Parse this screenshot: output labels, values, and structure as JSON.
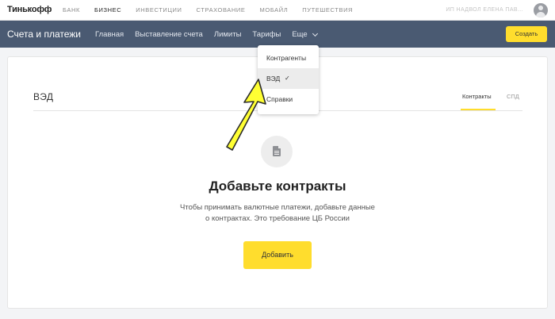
{
  "topbar": {
    "logo": "Тинькофф",
    "nav": [
      "БАНК",
      "БИЗНЕС",
      "ИНВЕСТИЦИИ",
      "СТРАХОВАНИЕ",
      "МОБАЙЛ",
      "ПУТЕШЕСТВИЯ"
    ],
    "active": "БИЗНЕС",
    "username": "ИП НАДВОЛ ЕЛЕНА ПАВ..."
  },
  "navbar": {
    "title": "Счета и платежи",
    "items": [
      "Главная",
      "Выставление счета",
      "Лимиты",
      "Тарифы",
      "Еще"
    ],
    "create_label": "Создать"
  },
  "dropdown": {
    "items": [
      {
        "label": "Контрагенты"
      },
      {
        "label": "ВЭД",
        "check": "✓"
      },
      {
        "label": "Справки"
      }
    ]
  },
  "card": {
    "title": "ВЭД",
    "tabs": [
      {
        "label": "Контракты"
      },
      {
        "label": "СПД"
      }
    ],
    "empty_title": "Добавьте контракты",
    "empty_desc_line1": "Чтобы принимать валютные платежи, добавьте данные",
    "empty_desc_line2": "о контрактах. Это требование ЦБ России",
    "add_label": "Добавить"
  },
  "colors": {
    "accent": "#ffdd2d",
    "navbar": "#4a5a72",
    "arrow": "#ffff33"
  }
}
